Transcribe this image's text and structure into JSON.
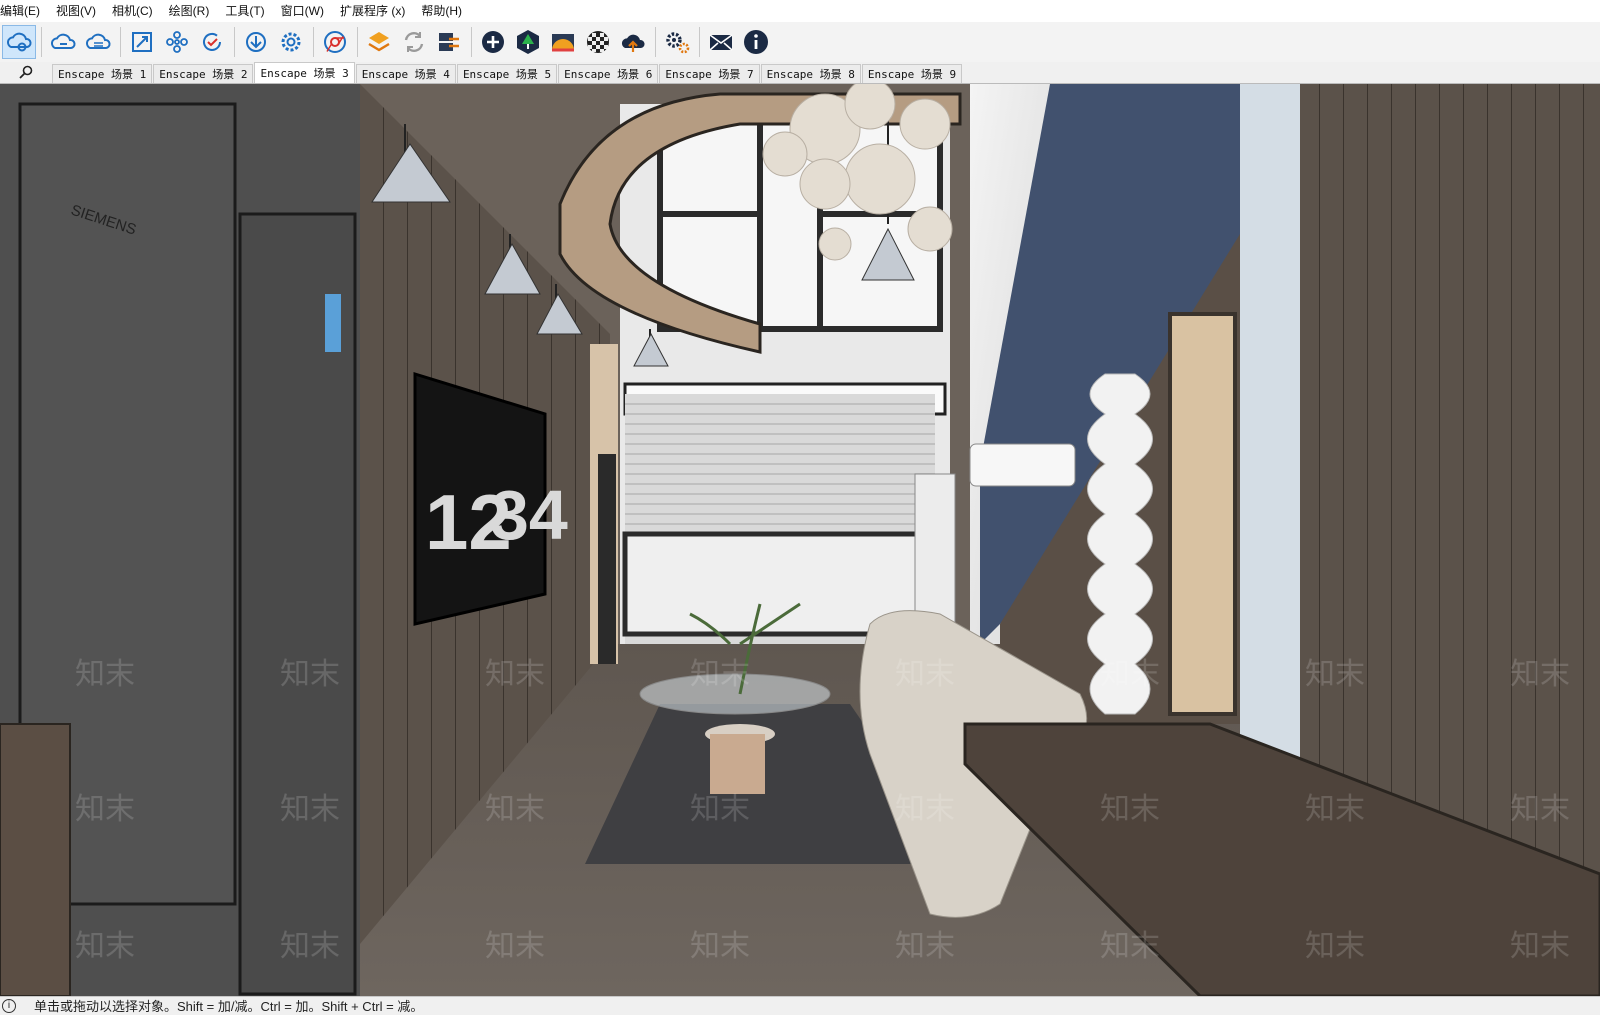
{
  "menu": {
    "items": [
      "编辑(E)",
      "视图(V)",
      "相机(C)",
      "绘图(R)",
      "工具(T)",
      "窗口(W)",
      "扩展程序 (x)",
      "帮助(H)"
    ]
  },
  "toolbar": {
    "icons": [
      "cloud-select-icon",
      "cloud-sync-icon",
      "cloud-upload-icon",
      "zoom-extents-icon",
      "components-icon",
      "refresh-check-icon",
      "download-icon",
      "settings-gear-icon",
      "chrome-icon",
      "enscape-start-icon",
      "enscape-sync-icon",
      "enscape-views-icon",
      "add-icon",
      "tree-asset-icon",
      "sun-sky-icon",
      "material-icon",
      "cloud-export-icon",
      "enscape-settings-icon",
      "mail-feedback-icon",
      "info-icon"
    ]
  },
  "scene_tabs": {
    "items": [
      "Enscape 场景 1",
      "Enscape 场景 2",
      "Enscape 场景 3",
      "Enscape 场景 4",
      "Enscape 场景 5",
      "Enscape 场景 6",
      "Enscape 场景 7",
      "Enscape 场景 8",
      "Enscape 场景 9"
    ],
    "active_index": 2
  },
  "viewport": {
    "fridge_brand": "SIEMENS",
    "clock_digits_left": "12",
    "clock_digits_right": "34",
    "watermark": "知末"
  },
  "status": {
    "info_glyph": "i",
    "message": "单击或拖动以选择对象。Shift = 加/减。Ctrl = 加。Shift + Ctrl = 减。"
  },
  "colors": {
    "accent_selected": "#cfe6fb",
    "wall_wood": "#5a4f46",
    "floor": "#6d655e"
  }
}
